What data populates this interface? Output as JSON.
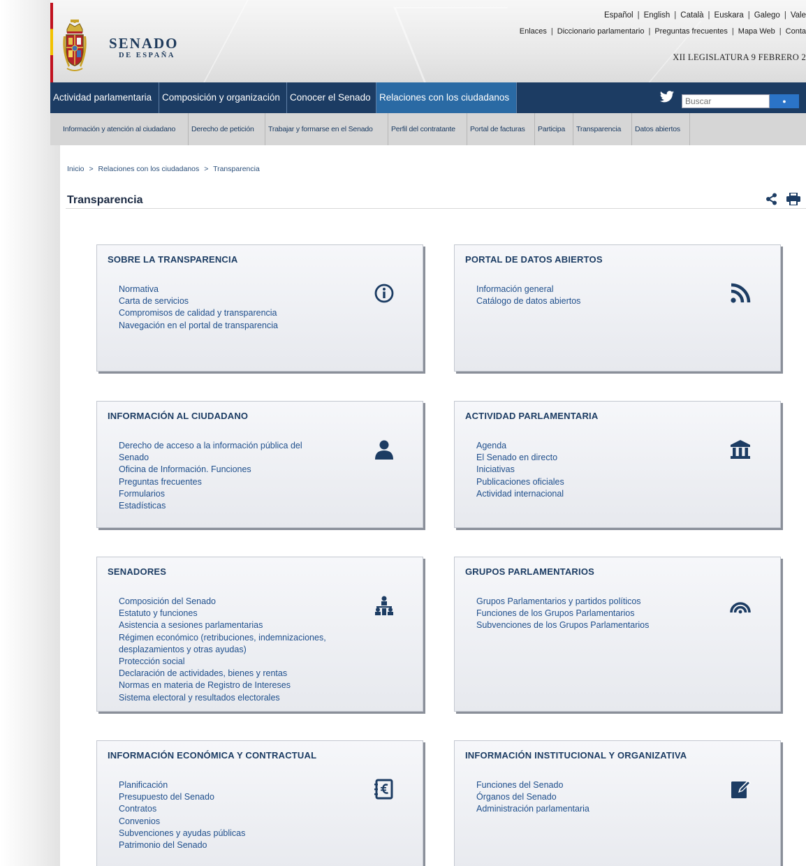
{
  "header": {
    "logo_title": "SENADO",
    "logo_subtitle": "DE ESPAÑA",
    "languages": [
      "Español",
      "English",
      "Català",
      "Euskara",
      "Galego",
      "Vale"
    ],
    "utility_links": [
      "Enlaces",
      "Diccionario parlamentario",
      "Preguntas frecuentes",
      "Mapa Web",
      "Conta"
    ],
    "legislatura": "XII LEGISLATURA 9 FEBRERO 2"
  },
  "main_nav": {
    "items": [
      "Actividad parlamentaria",
      "Composición y organización",
      "Conocer el Senado",
      "Relaciones con los ciudadanos"
    ],
    "active": "Relaciones con los ciudadanos",
    "search_placeholder": "Buscar"
  },
  "sub_nav": {
    "items": [
      "Información y atención al ciudadano",
      "Derecho de petición",
      "Trabajar y formarse en el Senado",
      "Perfil del contratante",
      "Portal de facturas",
      "Participa",
      "Transparencia",
      "Datos abiertos"
    ]
  },
  "breadcrumb": {
    "items": [
      "Inicio",
      "Relaciones con los ciudadanos",
      "Transparencia"
    ],
    "separator": ">"
  },
  "page": {
    "title": "Transparencia"
  },
  "colors": {
    "nav_bg": "#1c3c63",
    "nav_active": "#2a6aa4",
    "link": "#1f4f8c",
    "icon": "#1c3c63"
  },
  "cards": [
    {
      "title": "SOBRE LA TRANSPARENCIA",
      "icon": "info-icon",
      "links": [
        "Normativa",
        "Carta de servicios",
        "Compromisos de calidad y transparencia",
        "Navegación en el portal de transparencia"
      ]
    },
    {
      "title": "PORTAL DE DATOS ABIERTOS",
      "icon": "rss-icon",
      "links": [
        "Información general",
        "Catálogo de datos abiertos"
      ]
    },
    {
      "title": "INFORMACIÓN AL CIUDADANO",
      "icon": "user-icon",
      "links": [
        "Derecho de acceso a la información pública del Senado",
        "Oficina de Información. Funciones",
        "Preguntas frecuentes",
        "Formularios",
        "Estadísticas"
      ]
    },
    {
      "title": "ACTIVIDAD PARLAMENTARIA",
      "icon": "institution-icon",
      "links": [
        "Agenda",
        "El Senado en directo",
        "Iniciativas",
        "Publicaciones oficiales",
        "Actividad internacional"
      ]
    },
    {
      "title": "SENADORES",
      "icon": "hierarchy-icon",
      "links": [
        "Composición del Senado",
        "Estatuto y funciones",
        "Asistencia a sesiones parlamentarias",
        "Régimen económico (retribuciones, indemnizaciones, desplazamientos y otras ayudas)",
        "Protección social",
        "Declaración de actividades, bienes y rentas",
        "Normas en materia de Registro de Intereses",
        "Sistema electoral y resultados electorales"
      ]
    },
    {
      "title": "GRUPOS PARLAMENTARIOS",
      "icon": "hemicycle-icon",
      "links": [
        "Grupos Parlamentarios y partidos políticos",
        "Funciones de los Grupos Parlamentarios",
        "Subvenciones de los Grupos Parlamentarios"
      ]
    },
    {
      "title": "INFORMACIÓN ECONÓMICA Y CONTRACTUAL",
      "icon": "euro-ledger-icon",
      "links": [
        "Planificación",
        "Presupuesto del Senado",
        "Contratos",
        "Convenios",
        "Subvenciones y ayudas públicas",
        "Patrimonio del Senado"
      ]
    },
    {
      "title": "INFORMACIÓN INSTITUCIONAL Y ORGANIZATIVA",
      "icon": "edit-icon",
      "links": [
        "Funciones del Senado",
        "Órganos del Senado",
        "Administración parlamentaria"
      ]
    }
  ]
}
